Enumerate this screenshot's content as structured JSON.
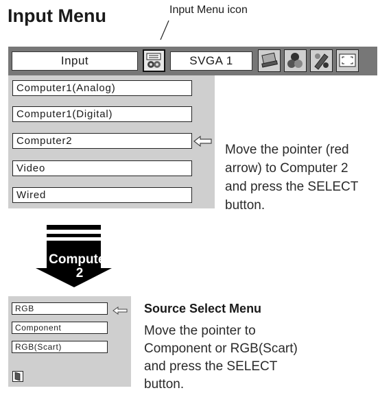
{
  "page": {
    "title": "Input Menu",
    "callout": "Input Menu icon"
  },
  "menubar": {
    "input_label": "Input",
    "signal_label": "SVGA 1",
    "icons": [
      "input-menu-icon",
      "pc-adjust-icon",
      "image-select-icon",
      "image-adjust-icon",
      "screen-icon"
    ]
  },
  "input_menu": {
    "items": [
      "Computer1(Analog)",
      "Computer1(Digital)",
      "Computer2",
      "Video",
      "Wired"
    ],
    "pointer_on": "Computer2"
  },
  "step1_text": [
    "Move the pointer (red",
    "arrow) to Computer 2",
    "and press the SELECT",
    "button."
  ],
  "transition": {
    "line1": "Computer",
    "line2": "2"
  },
  "source_menu": {
    "heading": "Source Select Menu",
    "items": [
      "RGB",
      "Component",
      "RGB(Scart)"
    ],
    "pointer_on": "Component",
    "exit_icon": "exit-icon"
  },
  "step2_text": [
    "Move the pointer to",
    "Component or RGB(Scart)",
    "and press the SELECT",
    "button."
  ]
}
